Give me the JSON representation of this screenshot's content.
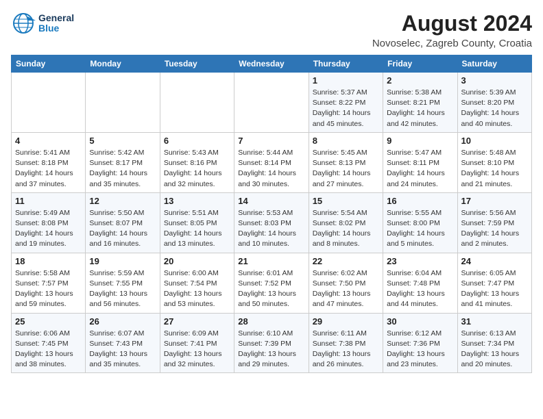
{
  "header": {
    "logo_line1": "General",
    "logo_line2": "Blue",
    "title": "August 2024",
    "subtitle": "Novoselec, Zagreb County, Croatia"
  },
  "weekdays": [
    "Sunday",
    "Monday",
    "Tuesday",
    "Wednesday",
    "Thursday",
    "Friday",
    "Saturday"
  ],
  "weeks": [
    [
      {
        "day": "",
        "info": ""
      },
      {
        "day": "",
        "info": ""
      },
      {
        "day": "",
        "info": ""
      },
      {
        "day": "",
        "info": ""
      },
      {
        "day": "1",
        "info": "Sunrise: 5:37 AM\nSunset: 8:22 PM\nDaylight: 14 hours\nand 45 minutes."
      },
      {
        "day": "2",
        "info": "Sunrise: 5:38 AM\nSunset: 8:21 PM\nDaylight: 14 hours\nand 42 minutes."
      },
      {
        "day": "3",
        "info": "Sunrise: 5:39 AM\nSunset: 8:20 PM\nDaylight: 14 hours\nand 40 minutes."
      }
    ],
    [
      {
        "day": "4",
        "info": "Sunrise: 5:41 AM\nSunset: 8:18 PM\nDaylight: 14 hours\nand 37 minutes."
      },
      {
        "day": "5",
        "info": "Sunrise: 5:42 AM\nSunset: 8:17 PM\nDaylight: 14 hours\nand 35 minutes."
      },
      {
        "day": "6",
        "info": "Sunrise: 5:43 AM\nSunset: 8:16 PM\nDaylight: 14 hours\nand 32 minutes."
      },
      {
        "day": "7",
        "info": "Sunrise: 5:44 AM\nSunset: 8:14 PM\nDaylight: 14 hours\nand 30 minutes."
      },
      {
        "day": "8",
        "info": "Sunrise: 5:45 AM\nSunset: 8:13 PM\nDaylight: 14 hours\nand 27 minutes."
      },
      {
        "day": "9",
        "info": "Sunrise: 5:47 AM\nSunset: 8:11 PM\nDaylight: 14 hours\nand 24 minutes."
      },
      {
        "day": "10",
        "info": "Sunrise: 5:48 AM\nSunset: 8:10 PM\nDaylight: 14 hours\nand 21 minutes."
      }
    ],
    [
      {
        "day": "11",
        "info": "Sunrise: 5:49 AM\nSunset: 8:08 PM\nDaylight: 14 hours\nand 19 minutes."
      },
      {
        "day": "12",
        "info": "Sunrise: 5:50 AM\nSunset: 8:07 PM\nDaylight: 14 hours\nand 16 minutes."
      },
      {
        "day": "13",
        "info": "Sunrise: 5:51 AM\nSunset: 8:05 PM\nDaylight: 14 hours\nand 13 minutes."
      },
      {
        "day": "14",
        "info": "Sunrise: 5:53 AM\nSunset: 8:03 PM\nDaylight: 14 hours\nand 10 minutes."
      },
      {
        "day": "15",
        "info": "Sunrise: 5:54 AM\nSunset: 8:02 PM\nDaylight: 14 hours\nand 8 minutes."
      },
      {
        "day": "16",
        "info": "Sunrise: 5:55 AM\nSunset: 8:00 PM\nDaylight: 14 hours\nand 5 minutes."
      },
      {
        "day": "17",
        "info": "Sunrise: 5:56 AM\nSunset: 7:59 PM\nDaylight: 14 hours\nand 2 minutes."
      }
    ],
    [
      {
        "day": "18",
        "info": "Sunrise: 5:58 AM\nSunset: 7:57 PM\nDaylight: 13 hours\nand 59 minutes."
      },
      {
        "day": "19",
        "info": "Sunrise: 5:59 AM\nSunset: 7:55 PM\nDaylight: 13 hours\nand 56 minutes."
      },
      {
        "day": "20",
        "info": "Sunrise: 6:00 AM\nSunset: 7:54 PM\nDaylight: 13 hours\nand 53 minutes."
      },
      {
        "day": "21",
        "info": "Sunrise: 6:01 AM\nSunset: 7:52 PM\nDaylight: 13 hours\nand 50 minutes."
      },
      {
        "day": "22",
        "info": "Sunrise: 6:02 AM\nSunset: 7:50 PM\nDaylight: 13 hours\nand 47 minutes."
      },
      {
        "day": "23",
        "info": "Sunrise: 6:04 AM\nSunset: 7:48 PM\nDaylight: 13 hours\nand 44 minutes."
      },
      {
        "day": "24",
        "info": "Sunrise: 6:05 AM\nSunset: 7:47 PM\nDaylight: 13 hours\nand 41 minutes."
      }
    ],
    [
      {
        "day": "25",
        "info": "Sunrise: 6:06 AM\nSunset: 7:45 PM\nDaylight: 13 hours\nand 38 minutes."
      },
      {
        "day": "26",
        "info": "Sunrise: 6:07 AM\nSunset: 7:43 PM\nDaylight: 13 hours\nand 35 minutes."
      },
      {
        "day": "27",
        "info": "Sunrise: 6:09 AM\nSunset: 7:41 PM\nDaylight: 13 hours\nand 32 minutes."
      },
      {
        "day": "28",
        "info": "Sunrise: 6:10 AM\nSunset: 7:39 PM\nDaylight: 13 hours\nand 29 minutes."
      },
      {
        "day": "29",
        "info": "Sunrise: 6:11 AM\nSunset: 7:38 PM\nDaylight: 13 hours\nand 26 minutes."
      },
      {
        "day": "30",
        "info": "Sunrise: 6:12 AM\nSunset: 7:36 PM\nDaylight: 13 hours\nand 23 minutes."
      },
      {
        "day": "31",
        "info": "Sunrise: 6:13 AM\nSunset: 7:34 PM\nDaylight: 13 hours\nand 20 minutes."
      }
    ]
  ]
}
